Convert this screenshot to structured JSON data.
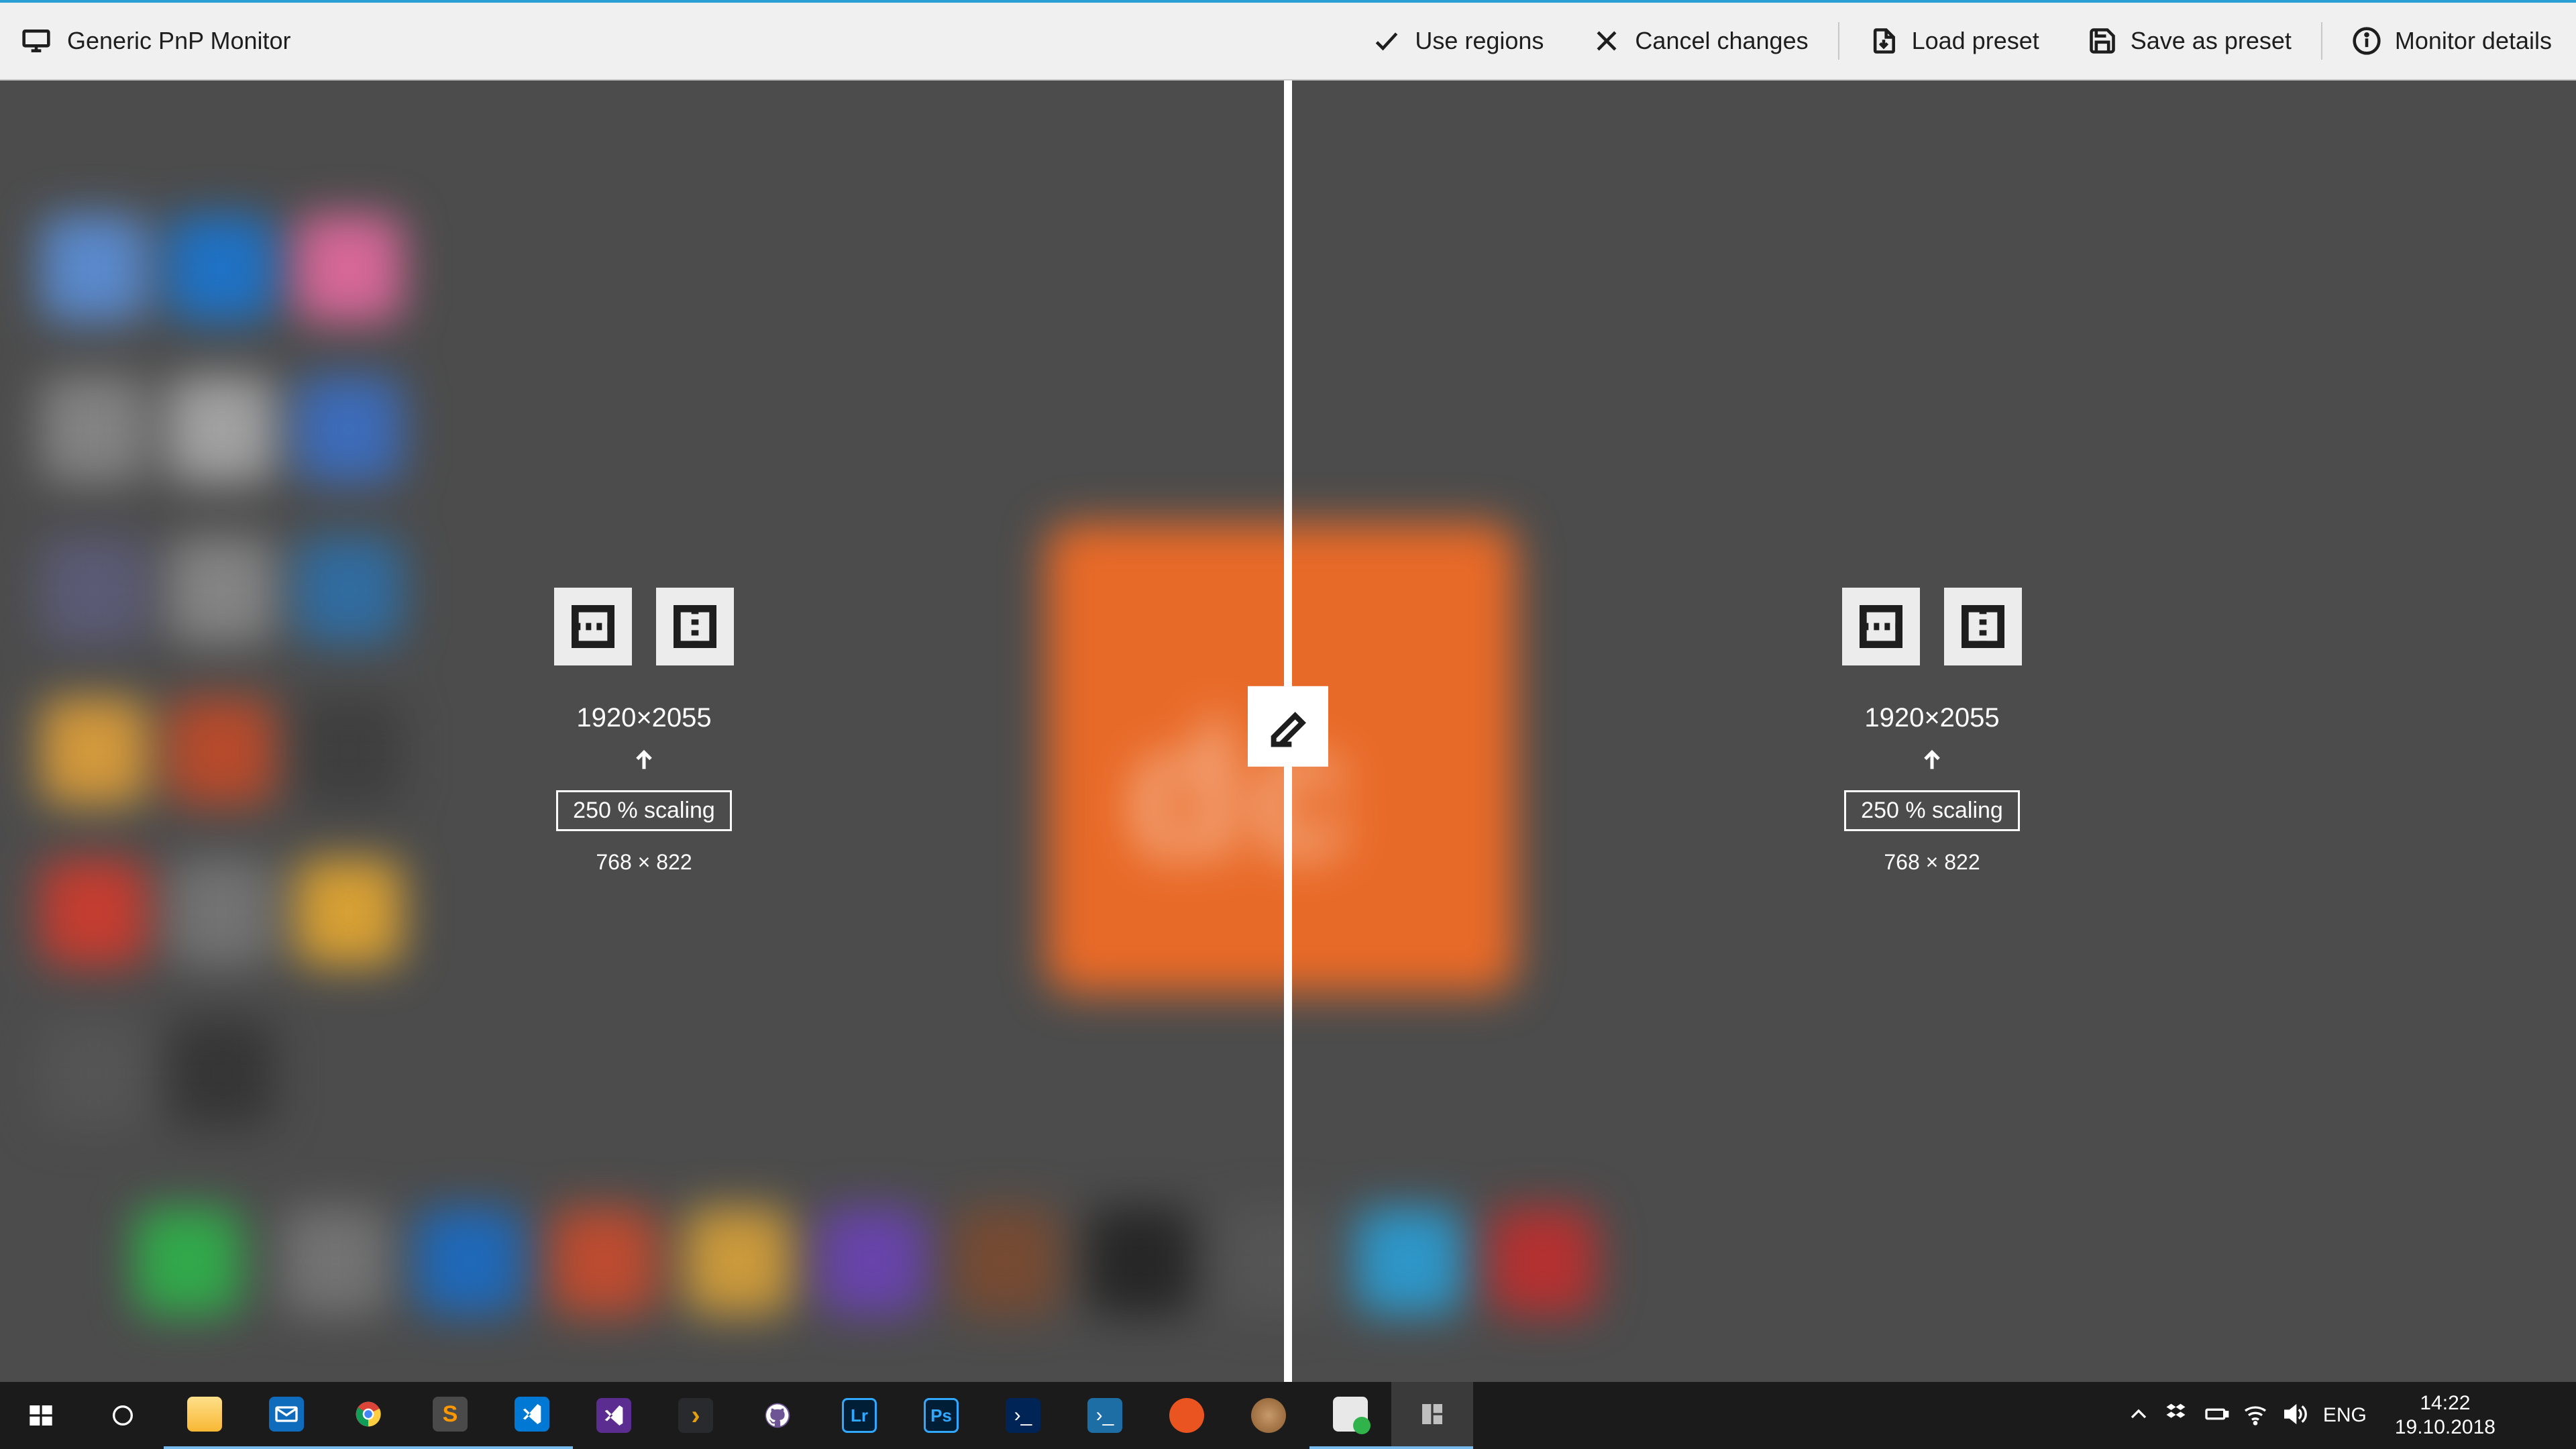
{
  "toolbar": {
    "monitor_name": "Generic PnP Monitor",
    "use_regions": "Use regions",
    "cancel_changes": "Cancel changes",
    "load_preset": "Load preset",
    "save_as_preset": "Save as preset",
    "monitor_details": "Monitor details"
  },
  "region_left": {
    "resolution": "1920×2055",
    "scaling": "250 % scaling",
    "scaled": "768 × 822"
  },
  "region_right": {
    "resolution": "1920×2055",
    "scaling": "250 % scaling",
    "scaled": "768 × 822"
  },
  "tray": {
    "lang": "ENG",
    "time": "14:22",
    "date": "19.10.2018"
  }
}
